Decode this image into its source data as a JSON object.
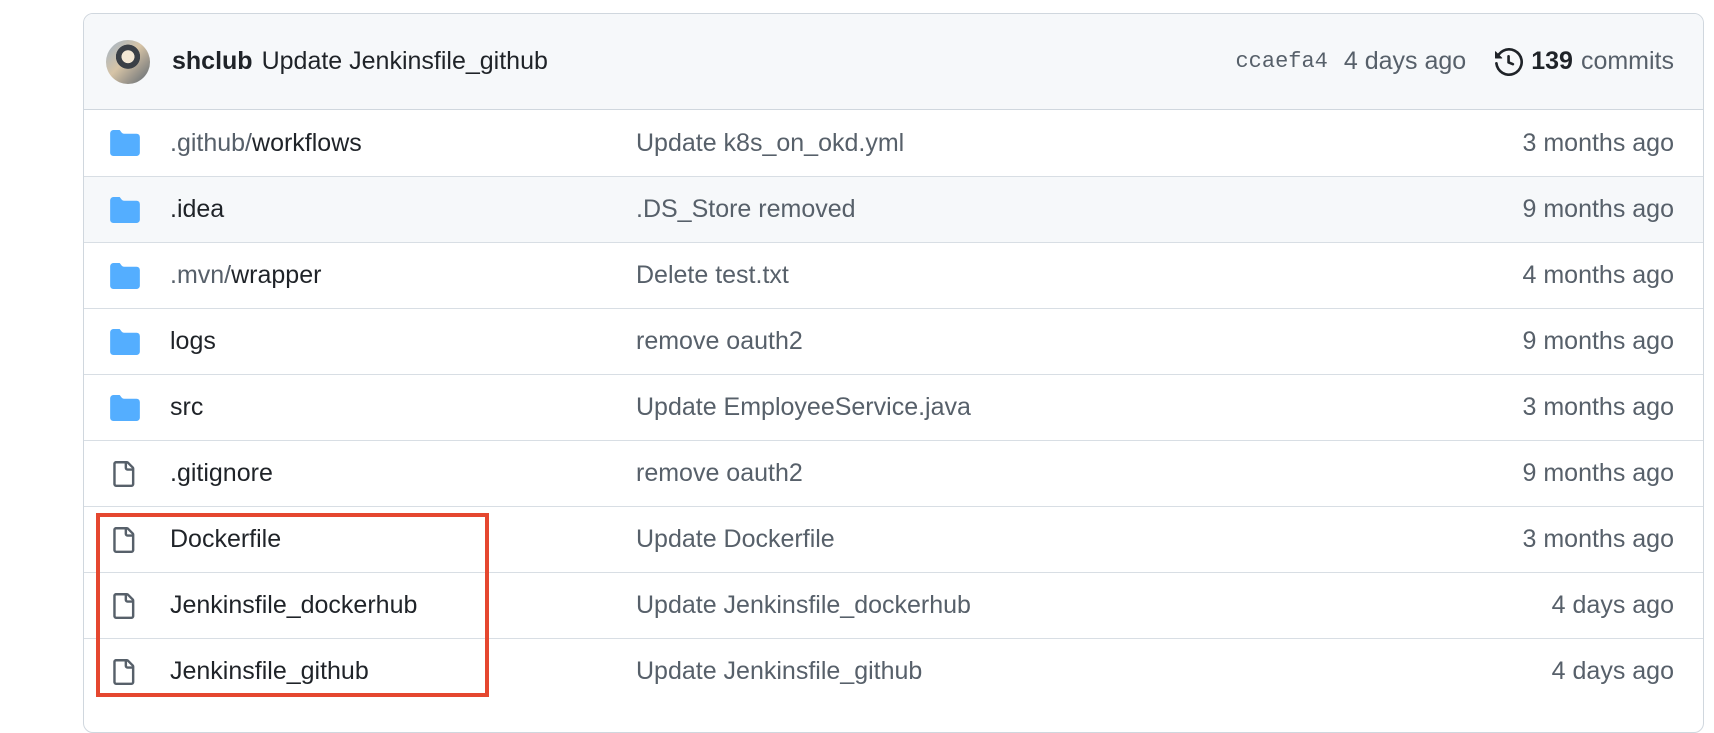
{
  "latest_commit": {
    "author": "shclub",
    "message": "Update Jenkinsfile_github",
    "sha": "ccaefa4",
    "age": "4 days ago",
    "commits_count": "139",
    "commits_label": "commits"
  },
  "files": [
    {
      "type": "folder",
      "prefix": ".github/",
      "name": "workflows",
      "message": "Update k8s_on_okd.yml",
      "age": "3 months ago"
    },
    {
      "type": "folder",
      "prefix": "",
      "name": ".idea",
      "message": ".DS_Store removed",
      "age": "9 months ago"
    },
    {
      "type": "folder",
      "prefix": ".mvn/",
      "name": "wrapper",
      "message": "Delete test.txt",
      "age": "4 months ago"
    },
    {
      "type": "folder",
      "prefix": "",
      "name": "logs",
      "message": "remove oauth2",
      "age": "9 months ago"
    },
    {
      "type": "folder",
      "prefix": "",
      "name": "src",
      "message": "Update EmployeeService.java",
      "age": "3 months ago"
    },
    {
      "type": "file",
      "prefix": "",
      "name": ".gitignore",
      "message": "remove oauth2",
      "age": "9 months ago"
    },
    {
      "type": "file",
      "prefix": "",
      "name": "Dockerfile",
      "message": "Update Dockerfile",
      "age": "3 months ago"
    },
    {
      "type": "file",
      "prefix": "",
      "name": "Jenkinsfile_dockerhub",
      "message": "Update Jenkinsfile_dockerhub",
      "age": "4 days ago"
    },
    {
      "type": "file",
      "prefix": "",
      "name": "Jenkinsfile_github",
      "message": "Update Jenkinsfile_github",
      "age": "4 days ago"
    }
  ],
  "colors": {
    "folder_icon": "#54aeff",
    "file_icon": "#57606a",
    "highlight": "#e5472f"
  }
}
